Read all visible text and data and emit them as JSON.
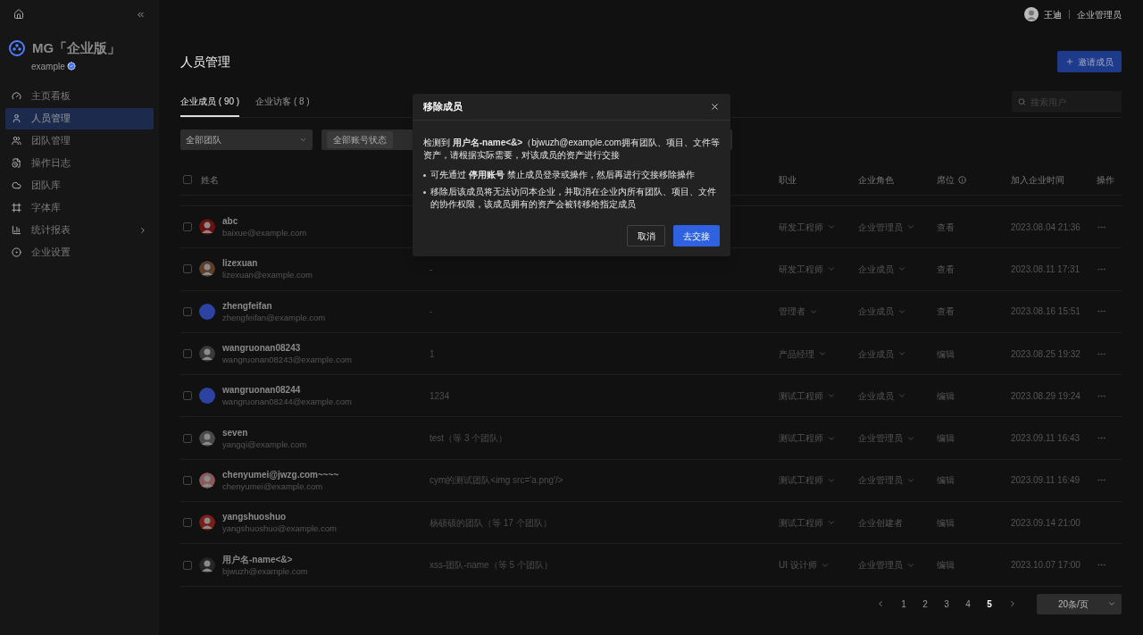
{
  "sidebar": {
    "brand": "MG「企业版」",
    "org": "example",
    "verified": true,
    "items": [
      {
        "label": "主页看板",
        "selected": false,
        "has_submenu": false
      },
      {
        "label": "人员管理",
        "selected": true,
        "has_submenu": false
      },
      {
        "label": "团队管理",
        "selected": false,
        "has_submenu": false
      },
      {
        "label": "操作日志",
        "selected": false,
        "has_submenu": false
      },
      {
        "label": "团队库",
        "selected": false,
        "has_submenu": false
      },
      {
        "label": "字体库",
        "selected": false,
        "has_submenu": false
      },
      {
        "label": "统计报表",
        "selected": false,
        "has_submenu": true
      },
      {
        "label": "企业设置",
        "selected": false,
        "has_submenu": false
      }
    ]
  },
  "user": {
    "name": "王迪",
    "role": "企业管理员"
  },
  "page_title": "人员管理",
  "invite_button": "邀请成员",
  "tabs": [
    {
      "label": "企业成员 ( 90 )",
      "selected": true
    },
    {
      "label": "企业访客 ( 8 )",
      "selected": false
    }
  ],
  "search": {
    "placeholder": "搜索用户"
  },
  "filters": {
    "team": "全部团队",
    "status_chip": "全部账号状态"
  },
  "table": {
    "select_all_checked": false,
    "columns": {
      "name": "姓名",
      "job": "职业",
      "role": "企业角色",
      "seat": "席位",
      "joined": "加入企业时间",
      "actions": "操作"
    },
    "rows": [
      {
        "name": "abc",
        "email": "baixue@example.com",
        "job": "研发工程师",
        "role": "企业管理员",
        "role_editable": true,
        "seat": "查看",
        "joined": "2023.08.04 21:36",
        "more": true,
        "checked": false
      },
      {
        "name": "lizexuan",
        "email": "lizexuan@example.com",
        "team": "-",
        "job": "研发工程师",
        "role": "企业成员",
        "role_editable": true,
        "seat": "查看",
        "joined": "2023.08.11 17:31",
        "more": true,
        "checked": false
      },
      {
        "name": "zhengfeifan",
        "email": "zhengfeifan@example.com",
        "avatar": {
          "kind": "plain",
          "color": "#2c43a3"
        },
        "team": "-",
        "job": "管理者",
        "role": "企业成员",
        "role_editable": true,
        "seat": "查看",
        "joined": "2023.08.16 15:51",
        "more": true,
        "checked": false
      },
      {
        "name": "wangruonan08243",
        "email": "wangruonan08243@example.com",
        "team": "1",
        "job": "产品经理",
        "role": "企业成员",
        "role_editable": true,
        "seat": "编辑",
        "joined": "2023.08.25 19:32",
        "more": true,
        "checked": false
      },
      {
        "name": "wangruonan08244",
        "email": "wangruonan08244@example.com",
        "avatar": {
          "kind": "plain",
          "color": "#2c43a3"
        },
        "team": "1234",
        "job": "测试工程师",
        "role": "企业成员",
        "role_editable": true,
        "seat": "编辑",
        "joined": "2023.08.29 19:24",
        "more": true,
        "checked": false
      },
      {
        "name": "seven",
        "email": "yangqi@example.com",
        "team": "test（等 3 个团队）",
        "job": "测试工程师",
        "role": "企业管理员",
        "role_editable": true,
        "seat": "编辑",
        "joined": "2023.09.11 16:43",
        "more": true,
        "checked": false
      },
      {
        "name": "chenyumei@jwzg.com~~~~",
        "email": "chenyumei@example.com",
        "team": "cym的测试团队<img src='a.png'/>",
        "job": "测试工程师",
        "role": "企业管理员",
        "role_editable": true,
        "seat": "编辑",
        "joined": "2023.09.11 16:49",
        "more": true,
        "checked": false
      },
      {
        "name": "yangshuoshuo",
        "email": "yangshuoshuo@example.com",
        "team": "杨硕硕的团队（等 17 个团队）",
        "job": "测试工程师",
        "role": "企业创建者",
        "role_editable": false,
        "seat": "编辑",
        "joined": "2023.09.14 21:00",
        "more": false,
        "checked": false
      },
      {
        "name": "用户名-name<&>",
        "email": "bjwuzh@example.com",
        "team": "xss-团队-name（等 5 个团队）",
        "job": "UI 设计师",
        "role": "企业管理员",
        "role_editable": true,
        "seat": "编辑",
        "joined": "2023.10.07 17:00",
        "more": true,
        "checked": false
      }
    ]
  },
  "pagination": {
    "pages": [
      {
        "label": "1",
        "selected": false
      },
      {
        "label": "2",
        "selected": false
      },
      {
        "label": "3",
        "selected": false
      },
      {
        "label": "4",
        "selected": false
      },
      {
        "label": "5",
        "selected": true
      }
    ],
    "page_size": "20条/页"
  },
  "dialog": {
    "title": "移除成员",
    "message": "检测到 **用户名-name<&>**（bjwuzh@example.com拥有团队、项目、文件等资产，请根据实际需要，对该成员的资产进行交接",
    "bullets": [
      "可先通过 **停用账号** 禁止成员登录或操作，然后再进行交接移除操作",
      "移除后该成员将无法访问本企业，并取消在企业内所有团队、项目、文件的协作权限，该成员拥有的资产会被转移给指定成员"
    ],
    "cancel": "取消",
    "confirm": "去交接"
  }
}
